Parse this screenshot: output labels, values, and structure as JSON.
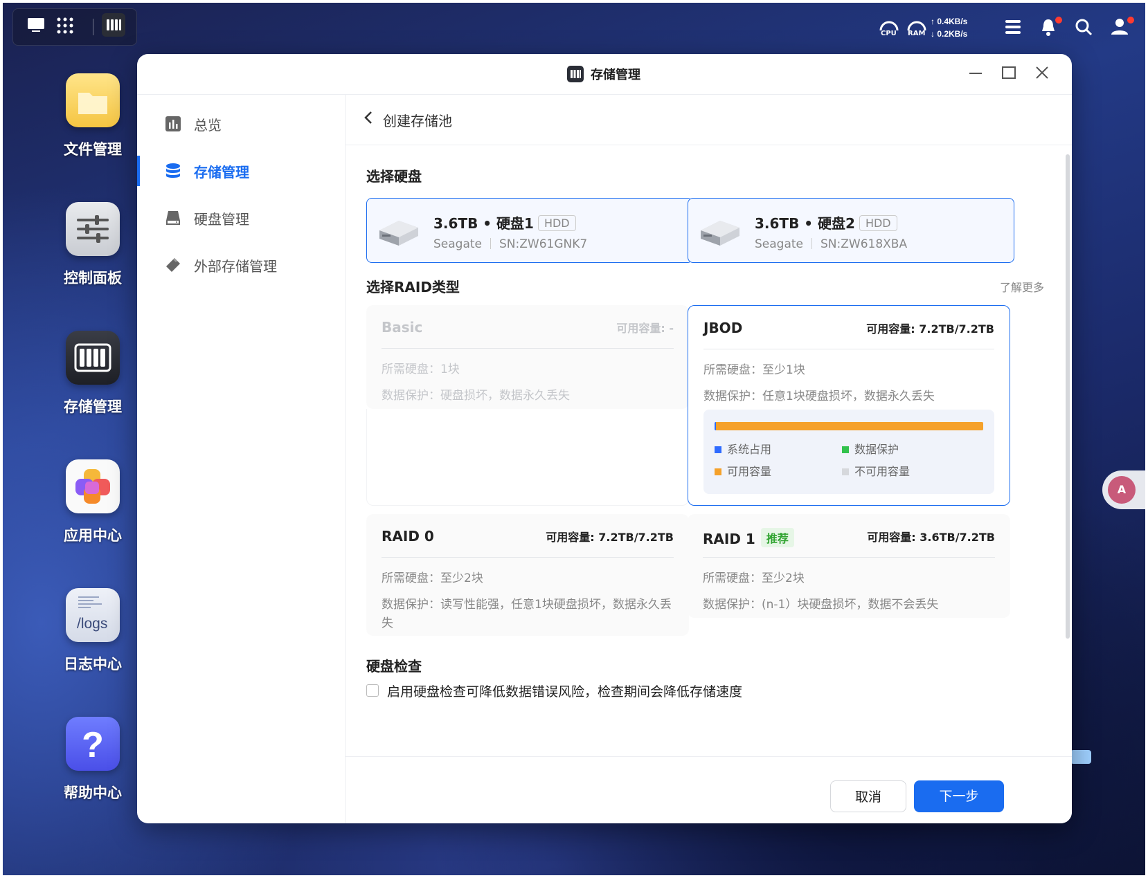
{
  "topbar": {
    "cpu": "CPU",
    "ram": "RAM",
    "up": "↑ 0.4KB/s",
    "down": "↓ 0.2KB/s"
  },
  "desktop": {
    "icons": [
      "文件管理",
      "控制面板",
      "存储管理",
      "应用中心",
      "日志中心",
      "帮助中心"
    ],
    "logs_text": "/logs"
  },
  "window": {
    "title": "存储管理",
    "nav": [
      "总览",
      "存储管理",
      "硬盘管理",
      "外部存储管理"
    ],
    "breadcrumb": "创建存储池",
    "select_disk_title": "选择硬盘",
    "disks": [
      {
        "size_name": "3.6TB • 硬盘1",
        "type": "HDD",
        "brand": "Seagate",
        "sn": "SN:ZW61GNK7"
      },
      {
        "size_name": "3.6TB • 硬盘2",
        "type": "HDD",
        "brand": "Seagate",
        "sn": "SN:ZW618XBA"
      }
    ],
    "raid_title": "选择RAID类型",
    "learn_more": "了解更多",
    "raids": [
      {
        "name": "Basic",
        "cap": "可用容量: -",
        "req": "所需硬盘：1块",
        "prot": "数据保护：硬盘损坏，数据永久丢失"
      },
      {
        "name": "JBOD",
        "cap": "可用容量: 7.2TB/7.2TB",
        "req": "所需硬盘：至少1块",
        "prot": "数据保护：任意1块硬盘损坏，数据永久丢失"
      },
      {
        "name": "RAID 0",
        "cap": "可用容量: 7.2TB/7.2TB",
        "req": "所需硬盘：至少2块",
        "prot": "数据保护：读写性能强，任意1块硬盘损坏，数据永久丢失"
      },
      {
        "name": "RAID 1",
        "badge": "推荐",
        "cap": "可用容量: 3.6TB/7.2TB",
        "req": "所需硬盘：至少2块",
        "prot": "数据保护：(n-1）块硬盘损坏，数据不会丢失"
      }
    ],
    "legend": [
      "系统占用",
      "数据保护",
      "可用容量",
      "不可用容量"
    ],
    "legend_colors": [
      "#2f6bff",
      "#33c24d",
      "#f5a12a",
      "#d6d8dc"
    ],
    "usage": {
      "system": 0.005,
      "available": 0.995
    },
    "check_title": "硬盘检查",
    "check_label": "启用硬盘检查可降低数据错误风险，检查期间会降低存储速度",
    "cancel": "取消",
    "next": "下一步"
  }
}
